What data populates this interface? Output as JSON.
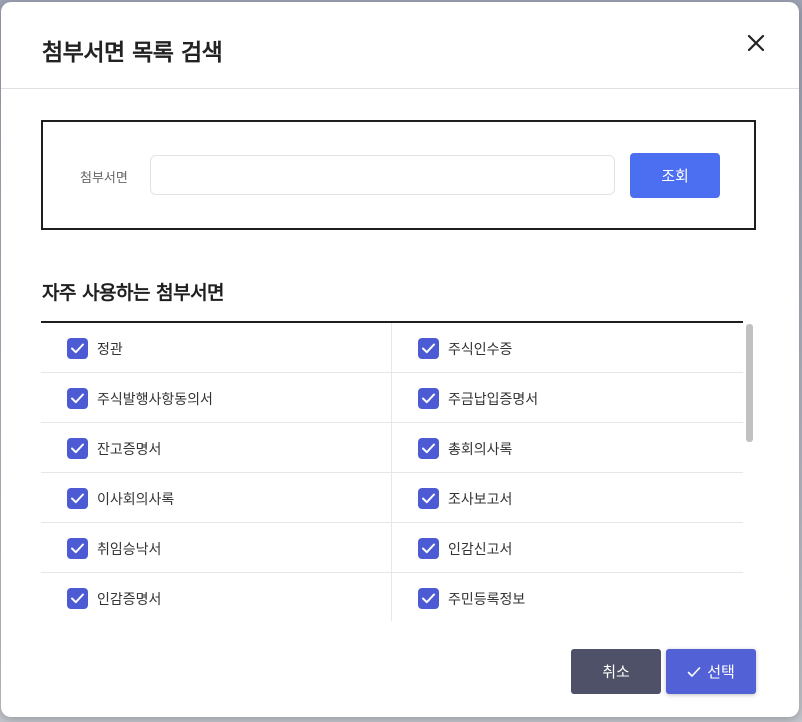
{
  "modal": {
    "title": "첨부서면 목록 검색"
  },
  "search": {
    "label": "첨부서면",
    "value": "",
    "placeholder": "",
    "button_label": "조회"
  },
  "favorites": {
    "title": "자주 사용하는 첨부서면",
    "rows": [
      {
        "left": {
          "label": "정관",
          "checked": true
        },
        "right": {
          "label": "주식인수증",
          "checked": true
        }
      },
      {
        "left": {
          "label": "주식발행사항동의서",
          "checked": true
        },
        "right": {
          "label": "주금납입증명서",
          "checked": true
        }
      },
      {
        "left": {
          "label": "잔고증명서",
          "checked": true
        },
        "right": {
          "label": "총회의사록",
          "checked": true
        }
      },
      {
        "left": {
          "label": "이사회의사록",
          "checked": true
        },
        "right": {
          "label": "조사보고서",
          "checked": true
        }
      },
      {
        "left": {
          "label": "취임승낙서",
          "checked": true
        },
        "right": {
          "label": "인감신고서",
          "checked": true
        }
      },
      {
        "left": {
          "label": "인감증명서",
          "checked": true
        },
        "right": {
          "label": "주민등록정보",
          "checked": true
        }
      }
    ]
  },
  "footer": {
    "cancel_label": "취소",
    "select_label": "선택"
  },
  "colors": {
    "primary": "#4c6ef0",
    "checkbox": "#4c5bd4",
    "cancel": "#4e5167",
    "select": "#5361d6"
  },
  "icons": {
    "close": "close-icon",
    "checkbox": "checkmark-icon",
    "select": "check-icon"
  }
}
